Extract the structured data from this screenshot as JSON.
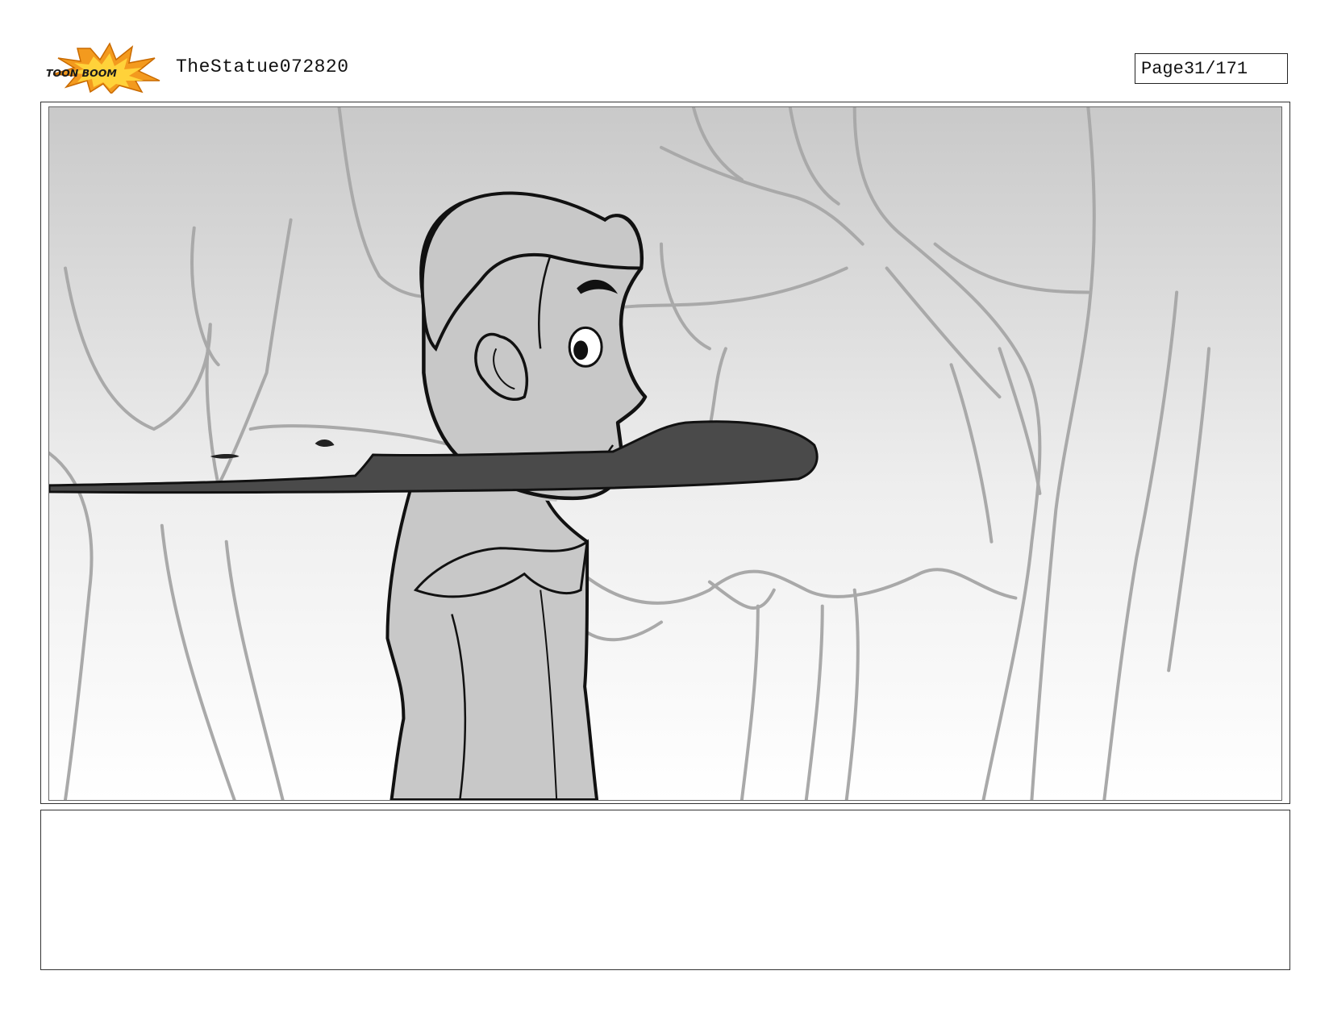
{
  "header": {
    "logo_name": "toon-boom-logo",
    "logo_text": "TOON BOOM",
    "title": "TheStatue072820",
    "page_label": "Page",
    "page_number": "31/171"
  },
  "panel": {
    "scene": "storyboard-sketch-boy-in-forest"
  },
  "caption": {
    "text": ""
  },
  "colors": {
    "logo_orange": "#f39a1e",
    "logo_yellow": "#ffd23a",
    "sketch_line": "#111111",
    "tree_line": "#a9a9a9",
    "skin_fill": "#c8c8c8",
    "shadow_fill": "#4a4a4a"
  }
}
